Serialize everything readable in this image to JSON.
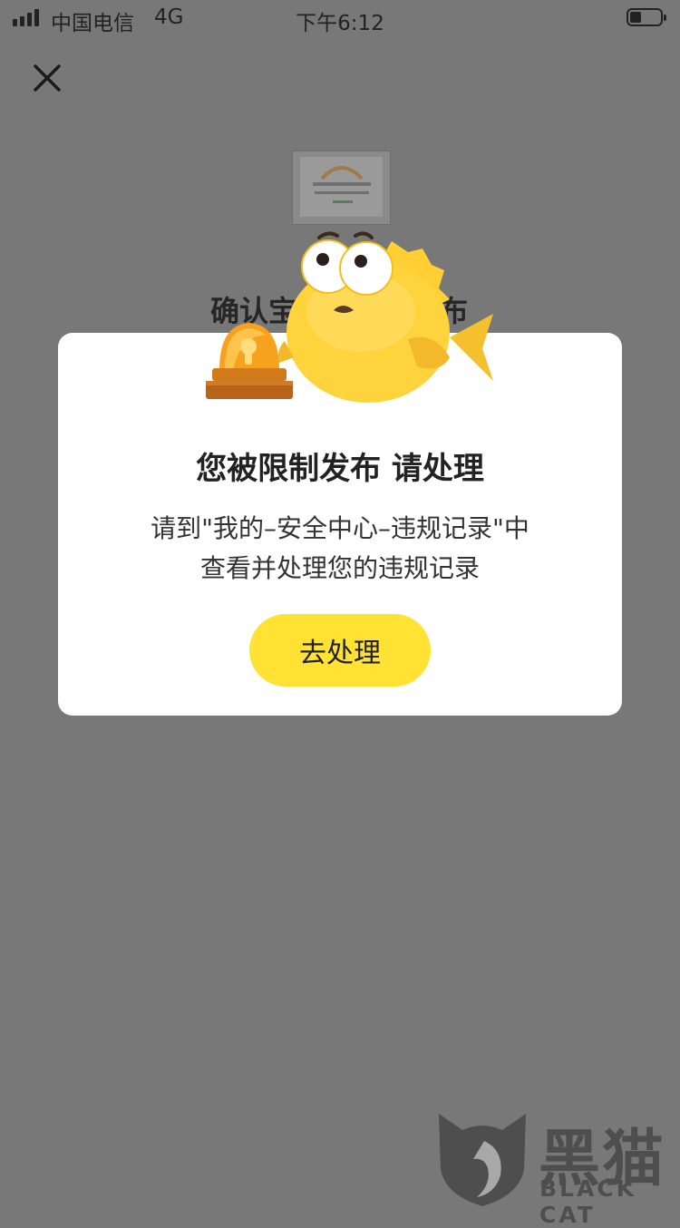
{
  "status_bar": {
    "carrier": "中国电信",
    "network": "4G",
    "time": "下午6:12",
    "icons": [
      "signal-icon",
      "battery-icon"
    ]
  },
  "header": {
    "close_icon": "close-icon"
  },
  "background_page": {
    "title_visible_start": "确认宝",
    "title_visible_end": "布"
  },
  "dialog": {
    "title": "您被限制发布 请处理",
    "body_line1": "请到\"我的–安全中心–违规记录\"中",
    "body_line2": "查看并处理您的违规记录",
    "button_label": "去处理",
    "illustrations": [
      "siren-icon",
      "fish-mascot"
    ]
  },
  "watermark": {
    "brand_cn": "黑猫",
    "brand_en": "BLACK CAT"
  },
  "colors": {
    "overlay": "#787878",
    "dialog_bg": "#ffffff",
    "button_accent": "#ffe234",
    "mascot_yellow": "#ffd33c"
  }
}
